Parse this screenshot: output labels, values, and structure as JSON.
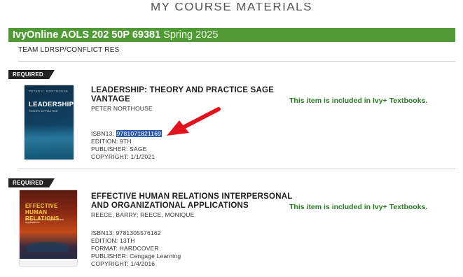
{
  "page": {
    "title": "MY COURSE MATERIALS"
  },
  "course": {
    "name": "IvyOnline AOLS 202 50P 69381",
    "term": "Spring 2025",
    "section": "TEAM LDRSP/CONFLICT RES"
  },
  "books": [
    {
      "tag": "REQUIRED",
      "title_line1": "LEADERSHIP: THEORY AND PRACTICE SAGE",
      "title_line2": "VANTAGE",
      "authors": "PETER NORTHOUSE",
      "isbn_label": "ISBN13:",
      "isbn": "9781071821169",
      "edition": "EDITION: 9TH",
      "publisher": "PUBLISHER: SAGE",
      "copyright": "COPYRIGHT: 1/1/2021",
      "included_text": "This item is included in Ivy+ Textbooks.",
      "cover": {
        "author": "PETER G. NORTHOUSE",
        "title": "LEADERSHIP",
        "subtitle": "THEORY & PRACTICE"
      }
    },
    {
      "tag": "REQUIRED",
      "title_line1": "EFFECTIVE HUMAN RELATIONS INTERPERSONAL",
      "title_line2": "AND ORGANIZATIONAL APPLICATIONS",
      "authors": "REECE, BARRY; REECE, MONIQUE",
      "isbn": "ISBN13: 9781305576162",
      "edition": "EDITION: 13TH",
      "format": "FORMAT: HARDCOVER",
      "publisher": "PUBLISHER: Cengage Learning",
      "copyright": "COPYRIGHT: 1/4/2016",
      "included_text": "This item is included in Ivy+ Textbooks.",
      "cover": {
        "title_line1": "EFFECTIVE",
        "title_line2": "HUMAN RELATIONS",
        "subtitle": "Interpersonal and Organizational Applications"
      }
    }
  ],
  "colors": {
    "course_bar": "#4f9a34",
    "included_text": "#2c7a25",
    "annotation_arrow": "#e0141e",
    "isbn_highlight": "#2c5ea8"
  }
}
